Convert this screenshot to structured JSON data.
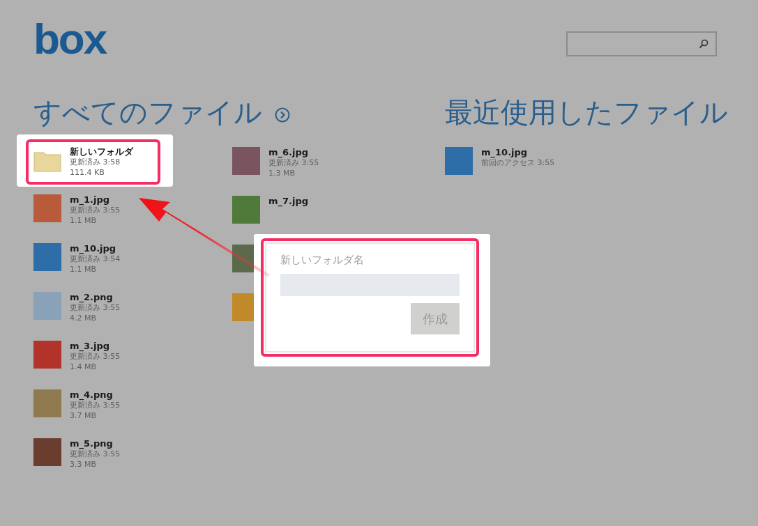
{
  "header": {
    "logo": "box"
  },
  "all_files": {
    "title": "すべてのファイル",
    "columns": [
      [
        {
          "kind": "folder",
          "name": "新しいフォルダ",
          "meta": "更新済み 3:58",
          "size": "111.4 KB",
          "selected": true
        },
        {
          "kind": "image",
          "name": "m_1.jpg",
          "meta": "更新済み 3:55",
          "size": "1.1 MB",
          "selected": false
        },
        {
          "kind": "image",
          "name": "m_10.jpg",
          "meta": "更新済み 3:54",
          "size": "1.1 MB",
          "selected": false
        },
        {
          "kind": "image",
          "name": "m_2.png",
          "meta": "更新済み 3:55",
          "size": "4.2 MB",
          "selected": false
        },
        {
          "kind": "image",
          "name": "m_3.jpg",
          "meta": "更新済み 3:55",
          "size": "1.4 MB",
          "selected": false
        },
        {
          "kind": "image",
          "name": "m_4.png",
          "meta": "更新済み 3:55",
          "size": "3.7 MB",
          "selected": false
        },
        {
          "kind": "image",
          "name": "m_5.png",
          "meta": "更新済み 3:55",
          "size": "3.3 MB",
          "selected": false
        }
      ],
      [
        {
          "kind": "image",
          "name": "m_6.jpg",
          "meta": "更新済み 3:55",
          "size": "1.3 MB",
          "selected": false
        },
        {
          "kind": "image",
          "name": "m_7.jpg",
          "selected": false
        },
        {
          "kind": "image",
          "selected": false
        },
        {
          "kind": "image",
          "selected": false
        }
      ]
    ]
  },
  "recent": {
    "title": "最近使用したファイル",
    "items": [
      {
        "kind": "image",
        "name": "m_10.jpg",
        "meta": "前回のアクセス 3:55"
      }
    ]
  },
  "dialog": {
    "label": "新しいフォルダ名",
    "button": "作成",
    "button_disabled": true
  }
}
